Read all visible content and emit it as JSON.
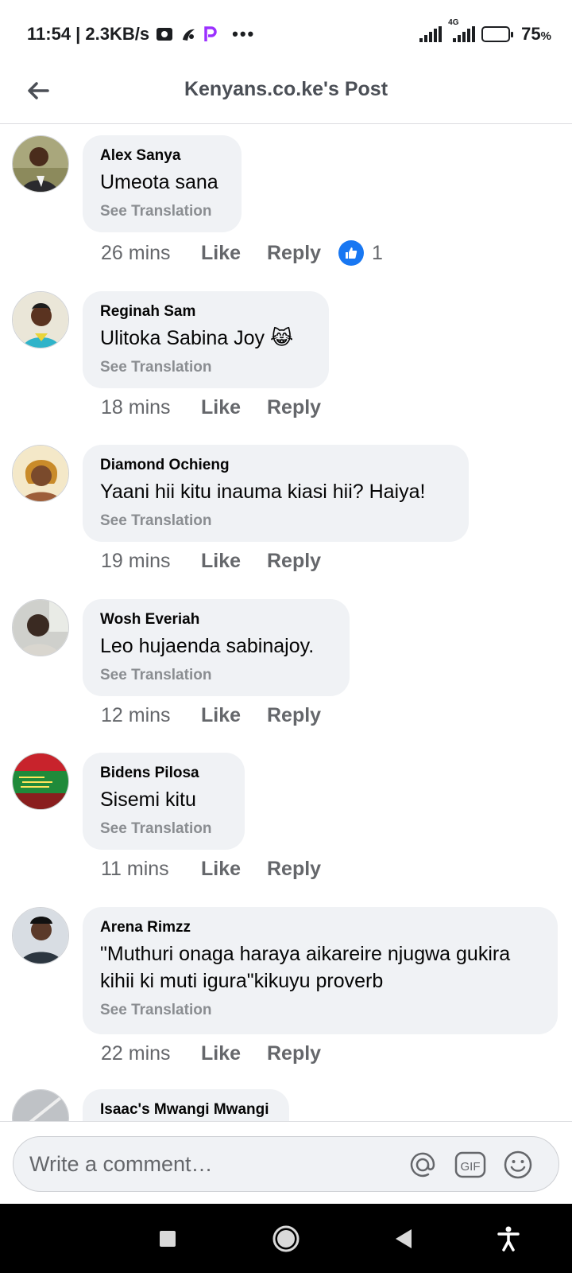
{
  "status_bar": {
    "time_speed": "11:54 | 2.3KB/s",
    "more": "•••",
    "network_label": "4G",
    "battery_percent": "75",
    "battery_unit": "%",
    "battery_level": 0.75
  },
  "header": {
    "title": "Kenyans.co.ke's Post"
  },
  "comments": [
    {
      "author": "Alex Sanya",
      "text": "Umeota sana",
      "translation": "See Translation",
      "time": "26 mins",
      "like": "Like",
      "reply": "Reply",
      "reaction_count": "1"
    },
    {
      "author": "Reginah Sam",
      "text": "Ulitoka Sabina Joy",
      "emoji": "😹",
      "translation": "See Translation",
      "time": "18 mins",
      "like": "Like",
      "reply": "Reply"
    },
    {
      "author": "Diamond Ochieng",
      "text": "Yaani hii kitu inauma kiasi hii? Haiya!",
      "translation": "See Translation",
      "time": "19 mins",
      "like": "Like",
      "reply": "Reply"
    },
    {
      "author": "Wosh Everiah",
      "text": "Leo hujaenda sabinajoy.",
      "translation": "See Translation",
      "time": "12 mins",
      "like": "Like",
      "reply": "Reply"
    },
    {
      "author": "Bidens Pilosa",
      "text": "Sisemi kitu",
      "translation": "See Translation",
      "time": "11 mins",
      "like": "Like",
      "reply": "Reply"
    },
    {
      "author": "Arena Rimzz",
      "text_line1": "\"Muthuri onaga haraya aikareire njugwa gukira",
      "text_line2": "kihii ki muti igura\"kikuyu proverb",
      "translation": "See Translation",
      "time": "22 mins",
      "like": "Like",
      "reply": "Reply"
    },
    {
      "author": "Isaac's Mwangi Mwangi"
    }
  ],
  "composer": {
    "placeholder": "Write a comment…",
    "gif_label": "GIF"
  },
  "icons": {
    "back": "arrow-left-icon",
    "mention": "at-icon",
    "gif": "gif-icon",
    "emoji": "smiley-icon",
    "like_reaction": "thumbs-up-icon"
  },
  "colors": {
    "bubble": "#f0f2f5",
    "secondary_text": "#65676b",
    "translation_text": "#8a8d91",
    "like_blue": "#1877f2"
  }
}
